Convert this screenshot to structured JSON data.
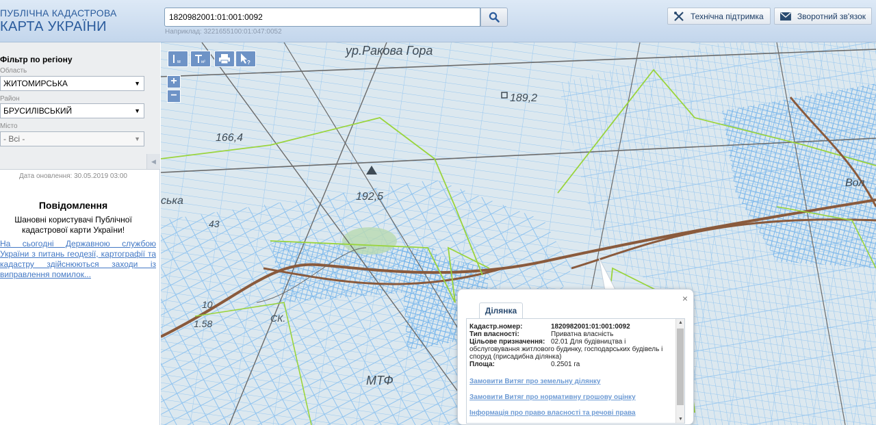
{
  "header": {
    "logo_line1": "ПУБЛІЧНА КАДАСТРОВА",
    "logo_line2": "КАРТА УКРАЇНИ",
    "search_value": "1820982001:01:001:0092",
    "search_example": "Наприклад: 3221655100:01:047:0052",
    "support_label": "Технічна підтримка",
    "feedback_label": "Зворотний зв'язок"
  },
  "filter": {
    "title": "Фільтр по регіону",
    "oblast_label": "Область",
    "oblast_value": "ЖИТОМИРСЬКА",
    "rayon_label": "Район",
    "rayon_value": "БРУСИЛІВСЬКИЙ",
    "misto_label": "Місто",
    "misto_value": "- Всі -"
  },
  "update_date": "Дата оновлення: 30.05.2019 03:00",
  "news": {
    "title": "Повідомлення",
    "greeting": "Шановні користувачі Публічної кадастрової карти України!",
    "link_text": "На сьогодні Державною службою України з питань геодезії, картографії та кадастру здійснюються заходи із виправлення помилок..."
  },
  "map": {
    "labels": [
      "ур.Ракова Гора",
      "189,2",
      "166,4",
      "192,5",
      "43",
      "ська",
      "СК.",
      "МТФ",
      "10",
      "1.58",
      "Вол"
    ]
  },
  "popup": {
    "tab": "Ділянка",
    "close": "×",
    "cad_label": "Кадастр.номер:",
    "cad_value": "1820982001:01:001:0092",
    "own_label": "Тип власності:",
    "own_value": "Приватна власність",
    "purpose_label": "Цільове призначення:",
    "purpose_value_1": "02.01 Для будівництва і",
    "purpose_value_2": "обслуговування житлового будинку, господарських будівель і",
    "purpose_value_3": "споруд (присадибна ділянка)",
    "area_label": "Площа:",
    "area_value": "0.2501 га",
    "link1": "Замовити Витяг про земельну ділянку",
    "link2": "Замовити Витяг про нормативну грошову оцінку",
    "link3": "Інформація про право власності та речові права"
  },
  "colors": {
    "header_text": "#2a5b9c",
    "tool_blue": "#6e93c6",
    "parcel_blue": "#8fc3ef",
    "boundary_green": "#9ad43c",
    "road_brown": "#8a5a3c",
    "link_blue": "#4177c4"
  }
}
